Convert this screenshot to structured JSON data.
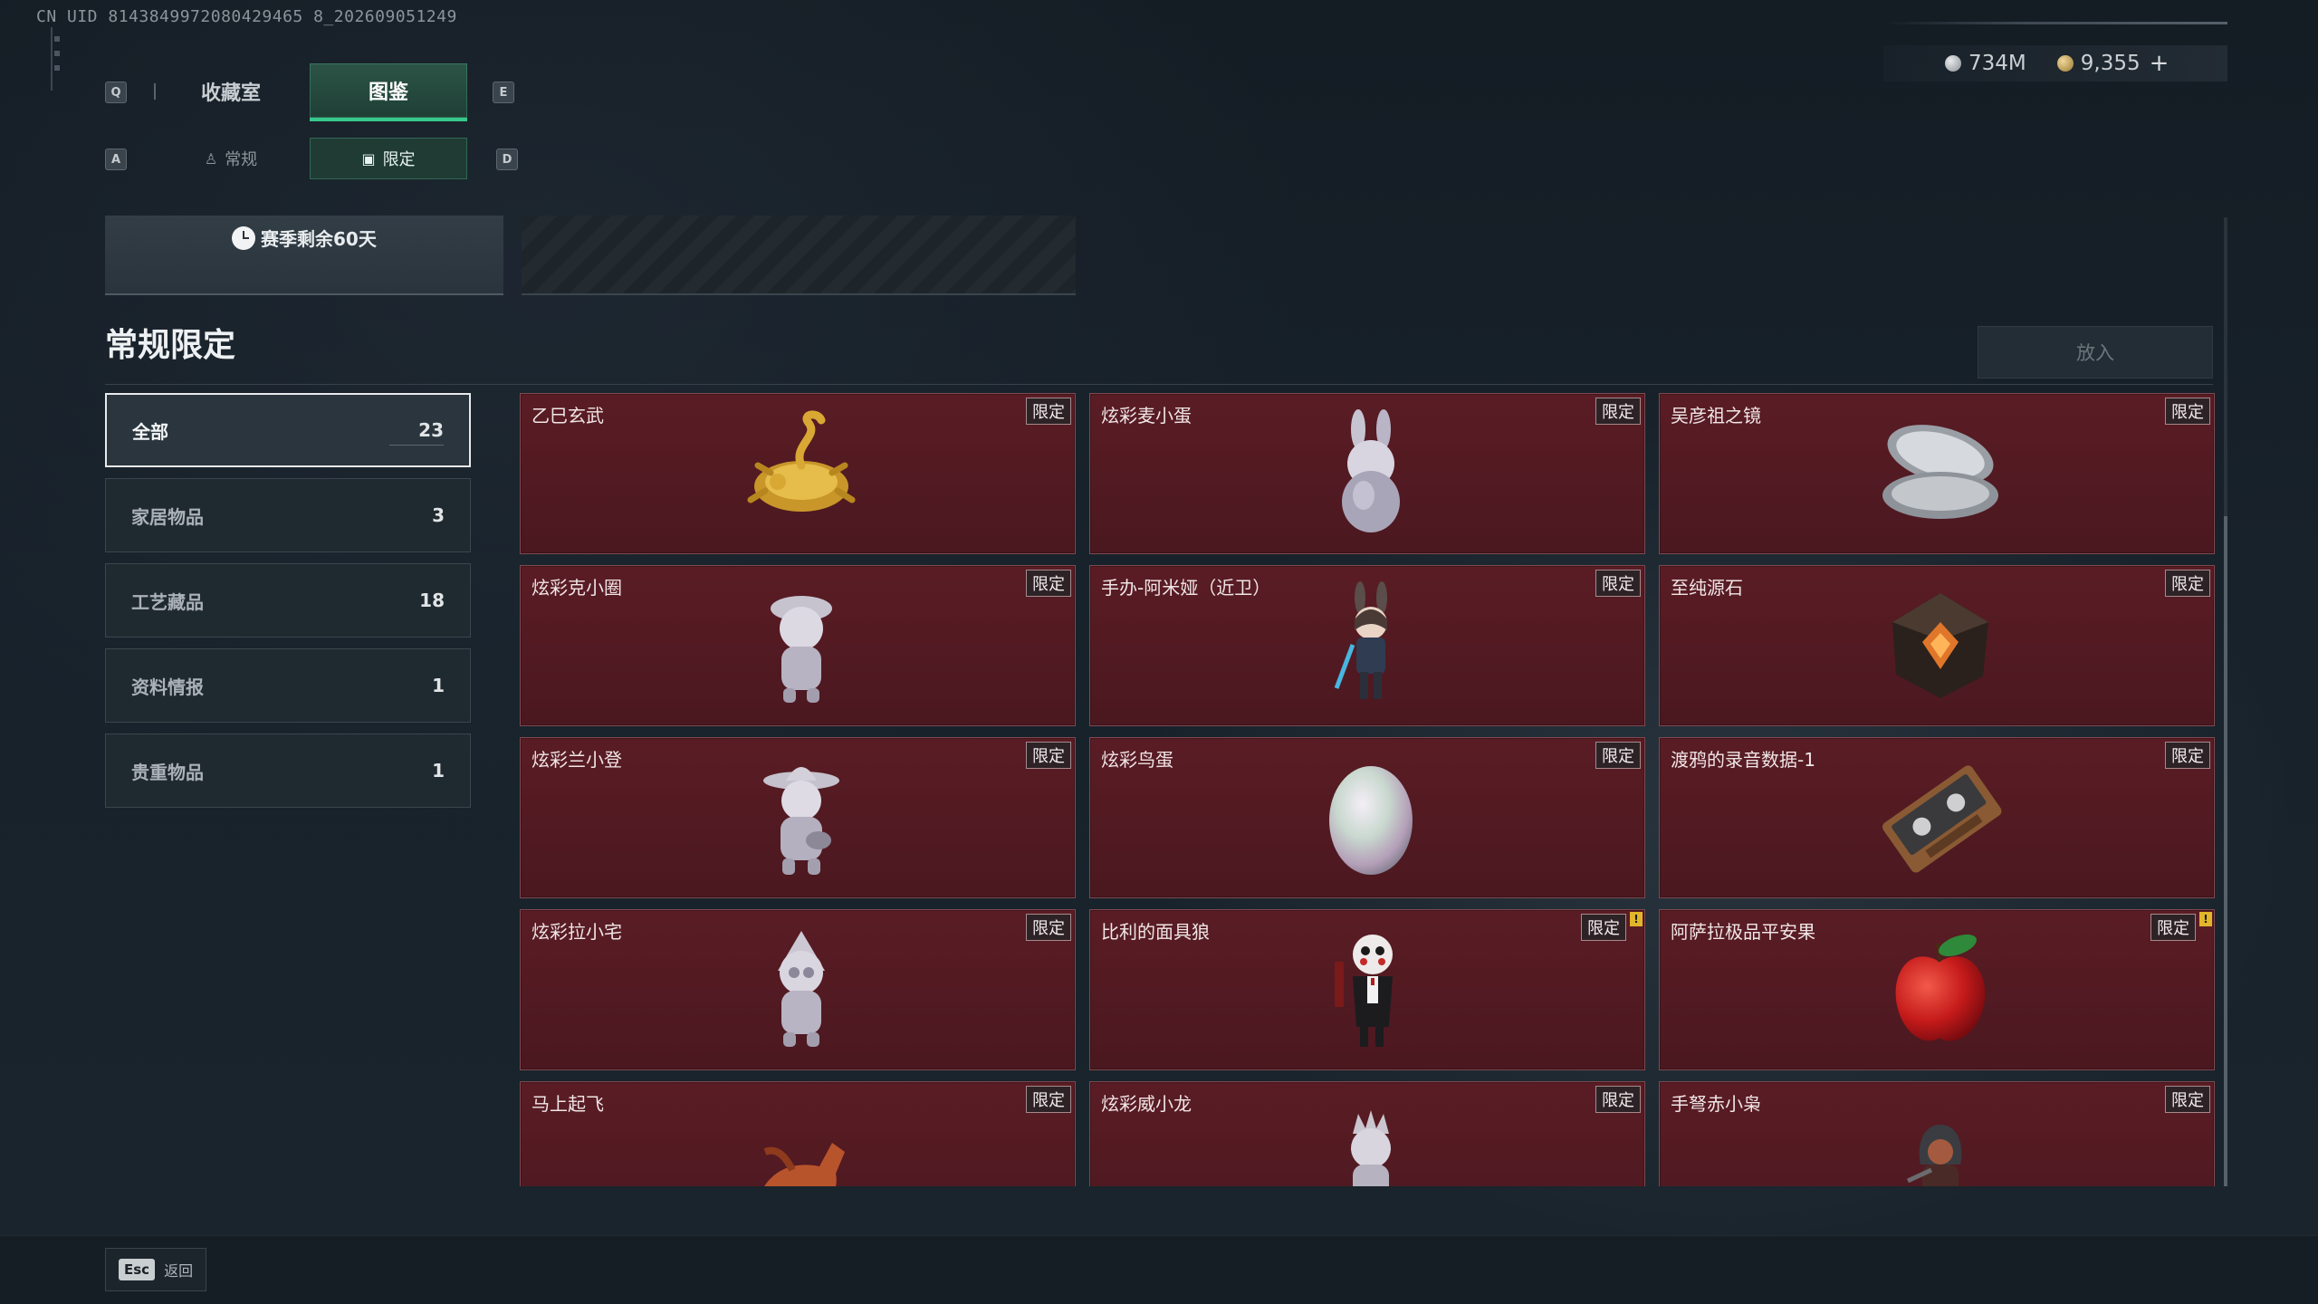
{
  "uid_text": "CN UID 8143849972080429465 8_202609051249",
  "currency": [
    {
      "icon": "silver-coin-icon",
      "value": "734M"
    },
    {
      "icon": "gold-coin-icon",
      "value": "9,355"
    }
  ],
  "currency_add": "+",
  "keys": {
    "prev_tab": "Q",
    "next_tab": "E",
    "prev_sub": "A",
    "next_sub": "D"
  },
  "tabs": [
    {
      "label": "收藏室",
      "active": false
    },
    {
      "label": "图鉴",
      "active": true
    }
  ],
  "subtabs": [
    {
      "label": "常规",
      "icon": "figure-icon",
      "active": false
    },
    {
      "label": "限定",
      "icon": "image-icon",
      "active": true
    }
  ],
  "season": {
    "text": "赛季剩余60天"
  },
  "section": {
    "title": "常规限定",
    "put_label": "放入"
  },
  "categories": [
    {
      "label": "全部",
      "count": "23",
      "active": true
    },
    {
      "label": "家居物品",
      "count": "3",
      "active": false
    },
    {
      "label": "工艺藏品",
      "count": "18",
      "active": false
    },
    {
      "label": "资料情报",
      "count": "1",
      "active": false
    },
    {
      "label": "贵重物品",
      "count": "1",
      "active": false
    }
  ],
  "items": [
    {
      "name": "乙巳玄武",
      "badge": "限定",
      "icon": "golden-snake-turtle-icon",
      "alert": false
    },
    {
      "name": "炫彩麦小蛋",
      "badge": "限定",
      "icon": "bunny-egg-figure-icon",
      "alert": false
    },
    {
      "name": "吴彦祖之镜",
      "badge": "限定",
      "icon": "compact-mirror-icon",
      "alert": false
    },
    {
      "name": "炫彩克小圈",
      "badge": "限定",
      "icon": "hat-figure-icon",
      "alert": false
    },
    {
      "name": "手办-阿米娅（近卫）",
      "badge": "限定",
      "icon": "amiya-figure-icon",
      "alert": false
    },
    {
      "name": "至纯源石",
      "badge": "限定",
      "icon": "originium-crystal-icon",
      "alert": false
    },
    {
      "name": "炫彩兰小登",
      "badge": "限定",
      "icon": "sombrero-figure-icon",
      "alert": false
    },
    {
      "name": "炫彩鸟蛋",
      "badge": "限定",
      "icon": "iridescent-egg-icon",
      "alert": false
    },
    {
      "name": "渡鸦的录音数据-1",
      "badge": "限定",
      "icon": "cassette-tape-icon",
      "alert": false
    },
    {
      "name": "炫彩拉小宅",
      "badge": "限定",
      "icon": "hooded-figure-icon",
      "alert": false
    },
    {
      "name": "比利的面具狼",
      "badge": "限定",
      "icon": "billy-puppet-icon",
      "alert": true
    },
    {
      "name": "阿萨拉极品平安果",
      "badge": "限定",
      "icon": "red-apple-icon",
      "alert": true
    },
    {
      "name": "马上起飞",
      "badge": "限定",
      "icon": "flying-horse-icon",
      "alert": false
    },
    {
      "name": "炫彩威小龙",
      "badge": "限定",
      "icon": "dragon-figure-icon",
      "alert": false
    },
    {
      "name": "手弩赤小枭",
      "badge": "限定",
      "icon": "crossbow-hood-figure-icon",
      "alert": false
    }
  ],
  "bottom": {
    "esc_key": "Esc",
    "esc_label": "返回"
  }
}
